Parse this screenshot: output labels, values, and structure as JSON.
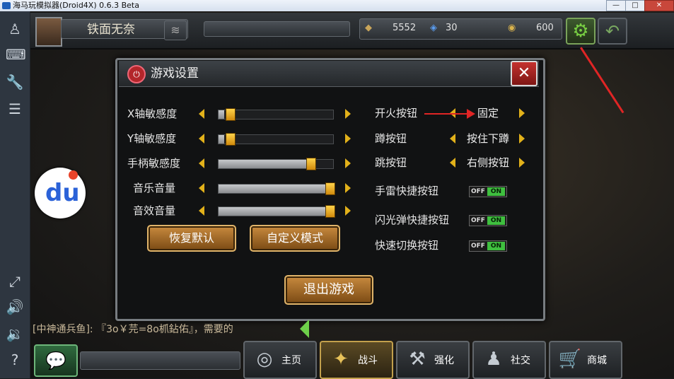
{
  "window": {
    "title": "海马玩模拟器(Droid4X) 0.6.3 Beta",
    "controls": [
      "—",
      "□",
      "✕"
    ]
  },
  "sidebar": {
    "icons": [
      "user-icon",
      "keyboard-icon",
      "wrench-icon",
      "list-icon",
      "fullscreen-icon",
      "volume-up-icon",
      "volume-down-icon",
      "help-icon"
    ]
  },
  "topbar": {
    "player_name": "铁面无奈",
    "gold": "5552",
    "diamond": "30",
    "medal": "600"
  },
  "settings": {
    "title": "游戏设置",
    "close": "✕",
    "sliders": [
      {
        "label": "X轴敏感度",
        "value": 0.05
      },
      {
        "label": "Y轴敏感度",
        "value": 0.05
      },
      {
        "label": "手柄敏感度",
        "value": 0.8
      },
      {
        "label": "音乐音量",
        "value": 0.97
      },
      {
        "label": "音效音量",
        "value": 0.97
      }
    ],
    "choices": [
      {
        "label": "开火按钮",
        "value": "固定"
      },
      {
        "label": "蹲按钮",
        "value": "按住下蹲"
      },
      {
        "label": "跳按钮",
        "value": "右侧按钮"
      }
    ],
    "toggles": [
      {
        "label": "手雷快捷按钮",
        "off": "OFF",
        "on": "ON",
        "state": "on"
      },
      {
        "label": "闪光弹快捷按钮",
        "off": "OFF",
        "on": "ON",
        "state": "on"
      },
      {
        "label": "快速切换按钮",
        "off": "OFF",
        "on": "ON",
        "state": "on"
      }
    ],
    "restore_default": "恢复默认",
    "custom_mode": "自定义模式",
    "exit_game": "退出游戏"
  },
  "chat": {
    "message": "[中神通兵鱼]: 『3o￥芫=8o枛鉆佑』，需要的"
  },
  "bottom_nav": [
    {
      "label": "主页",
      "icon": "home-icon"
    },
    {
      "label": "战斗",
      "icon": "battle-icon"
    },
    {
      "label": "强化",
      "icon": "tools-icon"
    },
    {
      "label": "社交",
      "icon": "social-icon"
    },
    {
      "label": "商城",
      "icon": "cart-icon"
    }
  ],
  "colors": {
    "accent_gold": "#e2b11a",
    "toggle_on": "#3fbf3f",
    "close_red": "#c4322f",
    "annotation_red": "#e02525"
  }
}
